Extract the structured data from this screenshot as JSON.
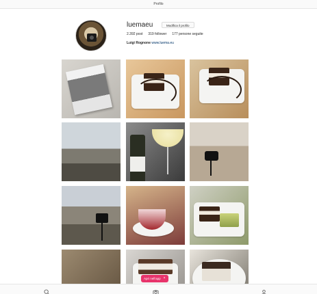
{
  "topbar": {
    "title": "Profilo"
  },
  "profile": {
    "username": "luemaeu",
    "edit_button": "Modifica il profilo",
    "stats": {
      "posts": "2.392 post",
      "followers": "319 follower",
      "following": "177 persone seguite"
    },
    "bio": {
      "name": "Luigi Rognone",
      "link": "www.luema.eu"
    }
  },
  "grid": {
    "tiles": [
      {
        "icon": "magazine-photo"
      },
      {
        "icon": "chocolate-cake-photo"
      },
      {
        "icon": "chocolate-cake-photo"
      },
      {
        "icon": "mountain-landscape-photo"
      },
      {
        "icon": "wine-glass-photo"
      },
      {
        "icon": "camera-on-rocks-photo"
      },
      {
        "icon": "camera-on-tripod-photo"
      },
      {
        "icon": "dessert-glass-photo"
      },
      {
        "icon": "chocolate-dessert-photo"
      },
      {
        "icon": "food-photo"
      },
      {
        "icon": "chocolate-cake-photo"
      },
      {
        "icon": "chocolate-cake-photo"
      }
    ]
  },
  "open_app": {
    "label": "Apri nell'app",
    "close": "×"
  },
  "bottombar": {
    "icons": [
      "search-icon",
      "camera-icon",
      "profile-icon"
    ]
  }
}
